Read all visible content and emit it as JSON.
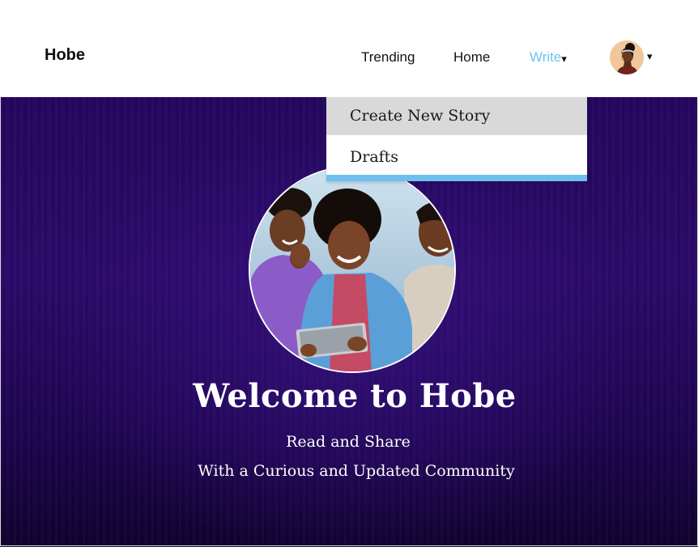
{
  "header": {
    "brand": "Hobe",
    "nav": {
      "trending": "Trending",
      "home": "Home",
      "write": "Write",
      "write_caret": "▾"
    },
    "avatar_caret": "▾"
  },
  "write_menu": {
    "items": [
      {
        "label": "Create New Story",
        "highlighted": true
      },
      {
        "label": "Drafts",
        "highlighted": false
      }
    ]
  },
  "hero": {
    "title": "Welcome to Hobe",
    "subtitle_line1": "Read and Share",
    "subtitle_line2": "With a Curious and Updated Community"
  },
  "icons": {
    "avatar": "user-avatar-icon",
    "hero_image": "group-with-tablet-photo",
    "caret": "chevron-down-icon"
  },
  "colors": {
    "accent": "#6ec1ef",
    "hero_bg": "#25075e",
    "menu_highlight": "#d9d9d9",
    "text": "#111111"
  }
}
